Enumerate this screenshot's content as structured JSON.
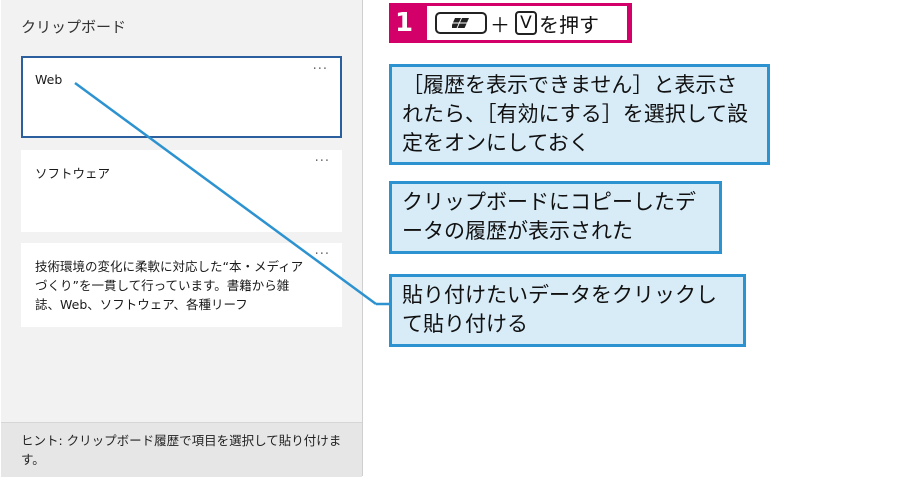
{
  "panel": {
    "title": "クリップボード",
    "cards": [
      {
        "text": "Web",
        "more": "···"
      },
      {
        "text": "ソフトウェア",
        "more": "···"
      },
      {
        "text": "技術環境の変化に柔軟に対応した“本・メディアづくり”を一貫して行っています。書籍から雑誌、Web、ソフトウェア、各種リーフ",
        "more": "···"
      }
    ],
    "hint": "ヒント: クリップボード履歴で項目を選択して貼り付けます。"
  },
  "step": {
    "number": "1",
    "plus": "＋",
    "key_v": "V",
    "suffix": "を押す",
    "win_icon": "windows-logo-icon"
  },
  "callouts": {
    "enable": "［履歴を表示できません］と表示されたら、［有効にする］を選択して設定をオンにしておく",
    "copied": "クリップボードにコピーしたデータの履歴が表示された",
    "paste": "貼り付けたいデータをクリックして貼り付ける"
  },
  "colors": {
    "step_bg": "#d4006a",
    "callout_bg": "#d8ecf8",
    "callout_border": "#2d93d0",
    "selected_border": "#2b5f9e"
  }
}
